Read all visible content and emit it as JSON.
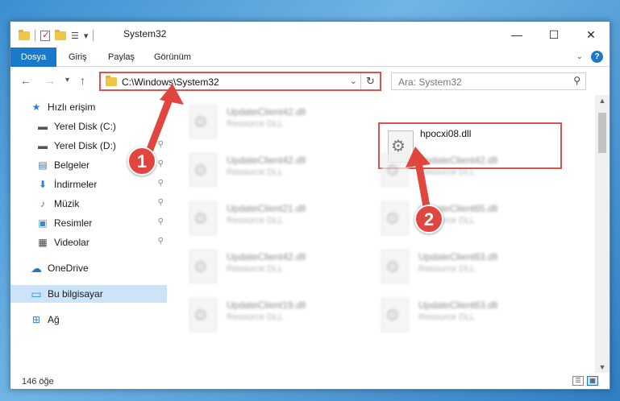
{
  "quick_access_toolbar": {
    "dropdown_glyph": "▾"
  },
  "window": {
    "title": "System32",
    "minimize": "—",
    "maximize": "☐",
    "close": "✕"
  },
  "ribbon": {
    "tabs": [
      {
        "label": "Dosya",
        "active": true
      },
      {
        "label": "Giriş",
        "active": false
      },
      {
        "label": "Paylaş",
        "active": false
      },
      {
        "label": "Görünüm",
        "active": false
      }
    ],
    "expand_glyph": "⌄",
    "help_glyph": "?"
  },
  "navigation": {
    "back": "←",
    "forward": "→",
    "recent": "▾",
    "up": "↑"
  },
  "address_bar": {
    "path": "C:\\Windows\\System32",
    "dropdown_glyph": "⌄",
    "refresh_glyph": "↻"
  },
  "search": {
    "placeholder": "Ara: System32",
    "icon_glyph": "⚲"
  },
  "nav_pane": {
    "items": [
      {
        "label": "Hızlı erişim",
        "icon": "star-icon",
        "glyph": "★",
        "color": "#2a7fd4",
        "pinned": false,
        "selected": false
      },
      {
        "label": "Yerel Disk (C:)",
        "icon": "drive-icon",
        "glyph": "▬",
        "color": "#555555",
        "pinned": true,
        "selected": false
      },
      {
        "label": "Yerel Disk (D:)",
        "icon": "drive-icon",
        "glyph": "▬",
        "color": "#555555",
        "pinned": true,
        "selected": false
      },
      {
        "label": "Belgeler",
        "icon": "document-icon",
        "glyph": "▤",
        "color": "#4a6fa5",
        "pinned": true,
        "selected": false
      },
      {
        "label": "İndirmeler",
        "icon": "download-icon",
        "glyph": "⬇",
        "color": "#2a7fd4",
        "pinned": true,
        "selected": false
      },
      {
        "label": "Müzik",
        "icon": "music-icon",
        "glyph": "♪",
        "color": "#2a7fd4",
        "pinned": true,
        "selected": false
      },
      {
        "label": "Resimler",
        "icon": "pictures-icon",
        "glyph": "▣",
        "color": "#3a86c8",
        "pinned": true,
        "selected": false
      },
      {
        "label": "Videolar",
        "icon": "video-icon",
        "glyph": "▦",
        "color": "#444444",
        "pinned": true,
        "selected": false
      },
      {
        "label": "OneDrive",
        "icon": "cloud-icon",
        "glyph": "☁",
        "color": "#1979ca",
        "pinned": false,
        "selected": false
      },
      {
        "label": "Bu bilgisayar",
        "icon": "computer-icon",
        "glyph": "▭",
        "color": "#2a7fd4",
        "pinned": false,
        "selected": true
      },
      {
        "label": "Ağ",
        "icon": "network-icon",
        "glyph": "⊞",
        "color": "#2a7fd4",
        "pinned": false,
        "selected": false
      }
    ],
    "pin_glyph": "📌"
  },
  "files": {
    "left_column": [
      {
        "name": "UpdateClient42.dll",
        "type": "Resource DLL"
      },
      {
        "name": "UpdateClient42.dll",
        "type": "Resource DLL"
      },
      {
        "name": "UpdateClient21.dll",
        "type": "Resource DLL"
      },
      {
        "name": "UpdateClient42.dll",
        "type": "Resource DLL"
      },
      {
        "name": "UpdateClient19.dll",
        "type": "Resource DLL"
      }
    ],
    "right_column": [
      {
        "name": "hpocxi08.dll",
        "type": "",
        "highlighted": true
      },
      {
        "name": "UpdateClient42.dll",
        "type": "Resource DLL"
      },
      {
        "name": "UpdateClient65.dll",
        "type": "Resource DLL"
      },
      {
        "name": "UpdateClient63.dll",
        "type": "Resource DLL"
      },
      {
        "name": "UpdateClient63.dll",
        "type": "Resource DLL"
      }
    ]
  },
  "scrollbar": {
    "up": "▲",
    "down": "▼"
  },
  "status": {
    "item_count": "146 öğe"
  },
  "annotations": {
    "step1": "1",
    "step2": "2",
    "color": "#e0463d"
  }
}
